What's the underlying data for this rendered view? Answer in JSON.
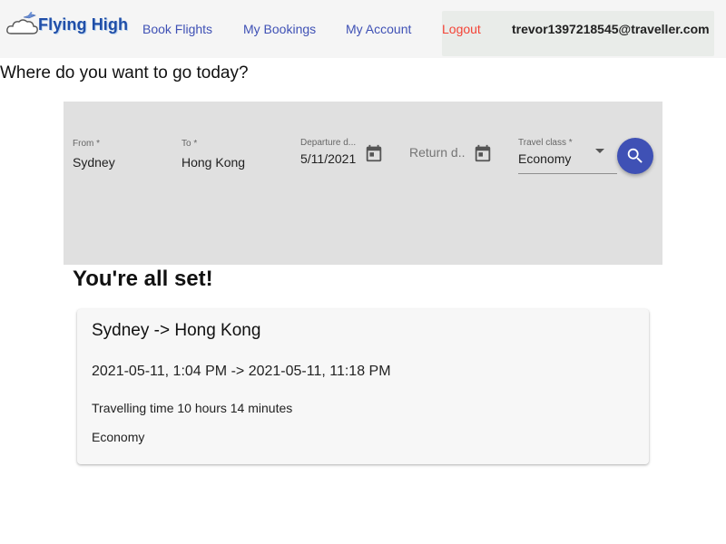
{
  "brand": {
    "name": "Flying High"
  },
  "nav": {
    "book_flights": "Book Flights",
    "my_bookings": "My Bookings",
    "my_account": "My Account",
    "logout": "Logout",
    "user_email": "trevor1397218545@traveller.com"
  },
  "headline": "Where do you want to go today?",
  "search": {
    "from_label": "From *",
    "from_value": "Sydney",
    "to_label": "To *",
    "to_value": "Hong Kong",
    "departure_label": "Departure d...",
    "departure_value": "5/11/2021",
    "return_placeholder": "Return d...",
    "class_label": "Travel class *",
    "class_value": "Economy",
    "search_icon": "search-icon",
    "calendar_icon": "calendar-icon"
  },
  "result": {
    "title": "You're all set!",
    "route": "Sydney -> Hong Kong",
    "times": "2021-05-11, 1:04 PM -> 2021-05-11, 11:18 PM",
    "duration": "Travelling time 10 hours 14 minutes",
    "travel_class": "Economy"
  },
  "colors": {
    "primary": "#3f51b5",
    "logout": "#f44336",
    "panel_bg": "#e0e0e0",
    "topbar_bg": "#f5f5f5"
  }
}
